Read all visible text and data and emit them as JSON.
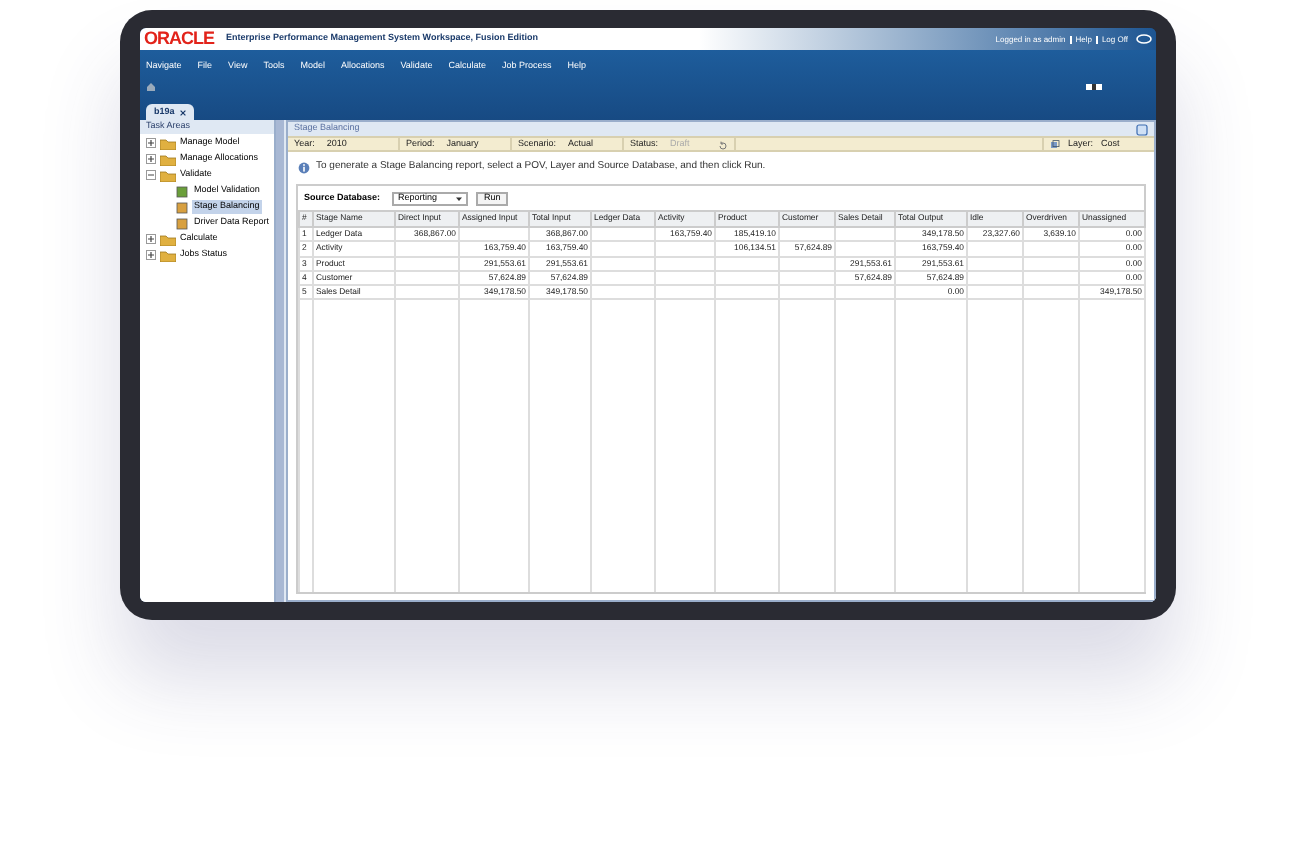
{
  "header": {
    "logo": "ORACLE",
    "title": "Enterprise Performance Management System Workspace, Fusion Edition",
    "user_links": [
      "Logged in as admin",
      "Help",
      "Log Off"
    ]
  },
  "menu": [
    "Navigate",
    "File",
    "View",
    "Tools",
    "Model",
    "Allocations",
    "Validate",
    "Calculate",
    "Job Process",
    "Help"
  ],
  "tabs": [
    {
      "label": "b19a",
      "selected": true
    }
  ],
  "sidebar": {
    "title": "Task Areas",
    "items": [
      {
        "label": "Manage Model",
        "kind": "folder",
        "expanded": false,
        "selected": false
      },
      {
        "label": "Manage Allocations",
        "kind": "folder",
        "expanded": false,
        "selected": false
      },
      {
        "label": "Validate",
        "kind": "folder",
        "expanded": true,
        "selected": false,
        "children": [
          {
            "label": "Model Validation",
            "kind": "task",
            "selected": false
          },
          {
            "label": "Stage Balancing",
            "kind": "task",
            "selected": true
          },
          {
            "label": "Driver Data Report",
            "kind": "task",
            "selected": false
          }
        ]
      },
      {
        "label": "Calculate",
        "kind": "folder",
        "expanded": false,
        "selected": false
      },
      {
        "label": "Jobs Status",
        "kind": "folder",
        "expanded": false,
        "selected": false
      }
    ]
  },
  "panel": {
    "title": "Stage Balancing",
    "pov": [
      {
        "label": "Year:",
        "value": "2010"
      },
      {
        "label": "Period:",
        "value": "January"
      },
      {
        "label": "Scenario:",
        "value": "Actual"
      },
      {
        "label": "Status:",
        "value": "Draft"
      }
    ],
    "layer": {
      "label": "Layer:",
      "value": "Cost"
    },
    "info": "To generate a Stage Balancing report, select a POV, Layer and Source Database, and then click Run.",
    "source_database": {
      "label": "Source Database:",
      "value": "Reporting",
      "button": "Run"
    },
    "table": {
      "columns": [
        "#",
        "Stage Name",
        "Direct Input",
        "Assigned Input",
        "Total Input",
        "Ledger Data",
        "Activity",
        "Product",
        "Customer",
        "Sales Detail",
        "Total Output",
        "Idle",
        "Overdriven",
        "Unassigned"
      ],
      "rows": [
        [
          "1",
          "Ledger Data",
          "368,867.00",
          "",
          "368,867.00",
          "",
          "163,759.40",
          "185,419.10",
          "",
          "",
          "349,178.50",
          "23,327.60",
          "3,639.10",
          "0.00"
        ],
        [
          "2",
          "Activity",
          "",
          "163,759.40",
          "163,759.40",
          "",
          "",
          "106,134.51",
          "57,624.89",
          "",
          "163,759.40",
          "",
          "",
          "0.00"
        ],
        [
          "3",
          "Product",
          "",
          "291,553.61",
          "291,553.61",
          "",
          "",
          "",
          "",
          "291,553.61",
          "291,553.61",
          "",
          "",
          "0.00"
        ],
        [
          "4",
          "Customer",
          "",
          "57,624.89",
          "57,624.89",
          "",
          "",
          "",
          "",
          "57,624.89",
          "57,624.89",
          "",
          "",
          "0.00"
        ],
        [
          "5",
          "Sales Detail",
          "",
          "349,178.50",
          "349,178.50",
          "",
          "",
          "",
          "",
          "",
          "0.00",
          "",
          "",
          "349,178.50"
        ]
      ]
    }
  }
}
